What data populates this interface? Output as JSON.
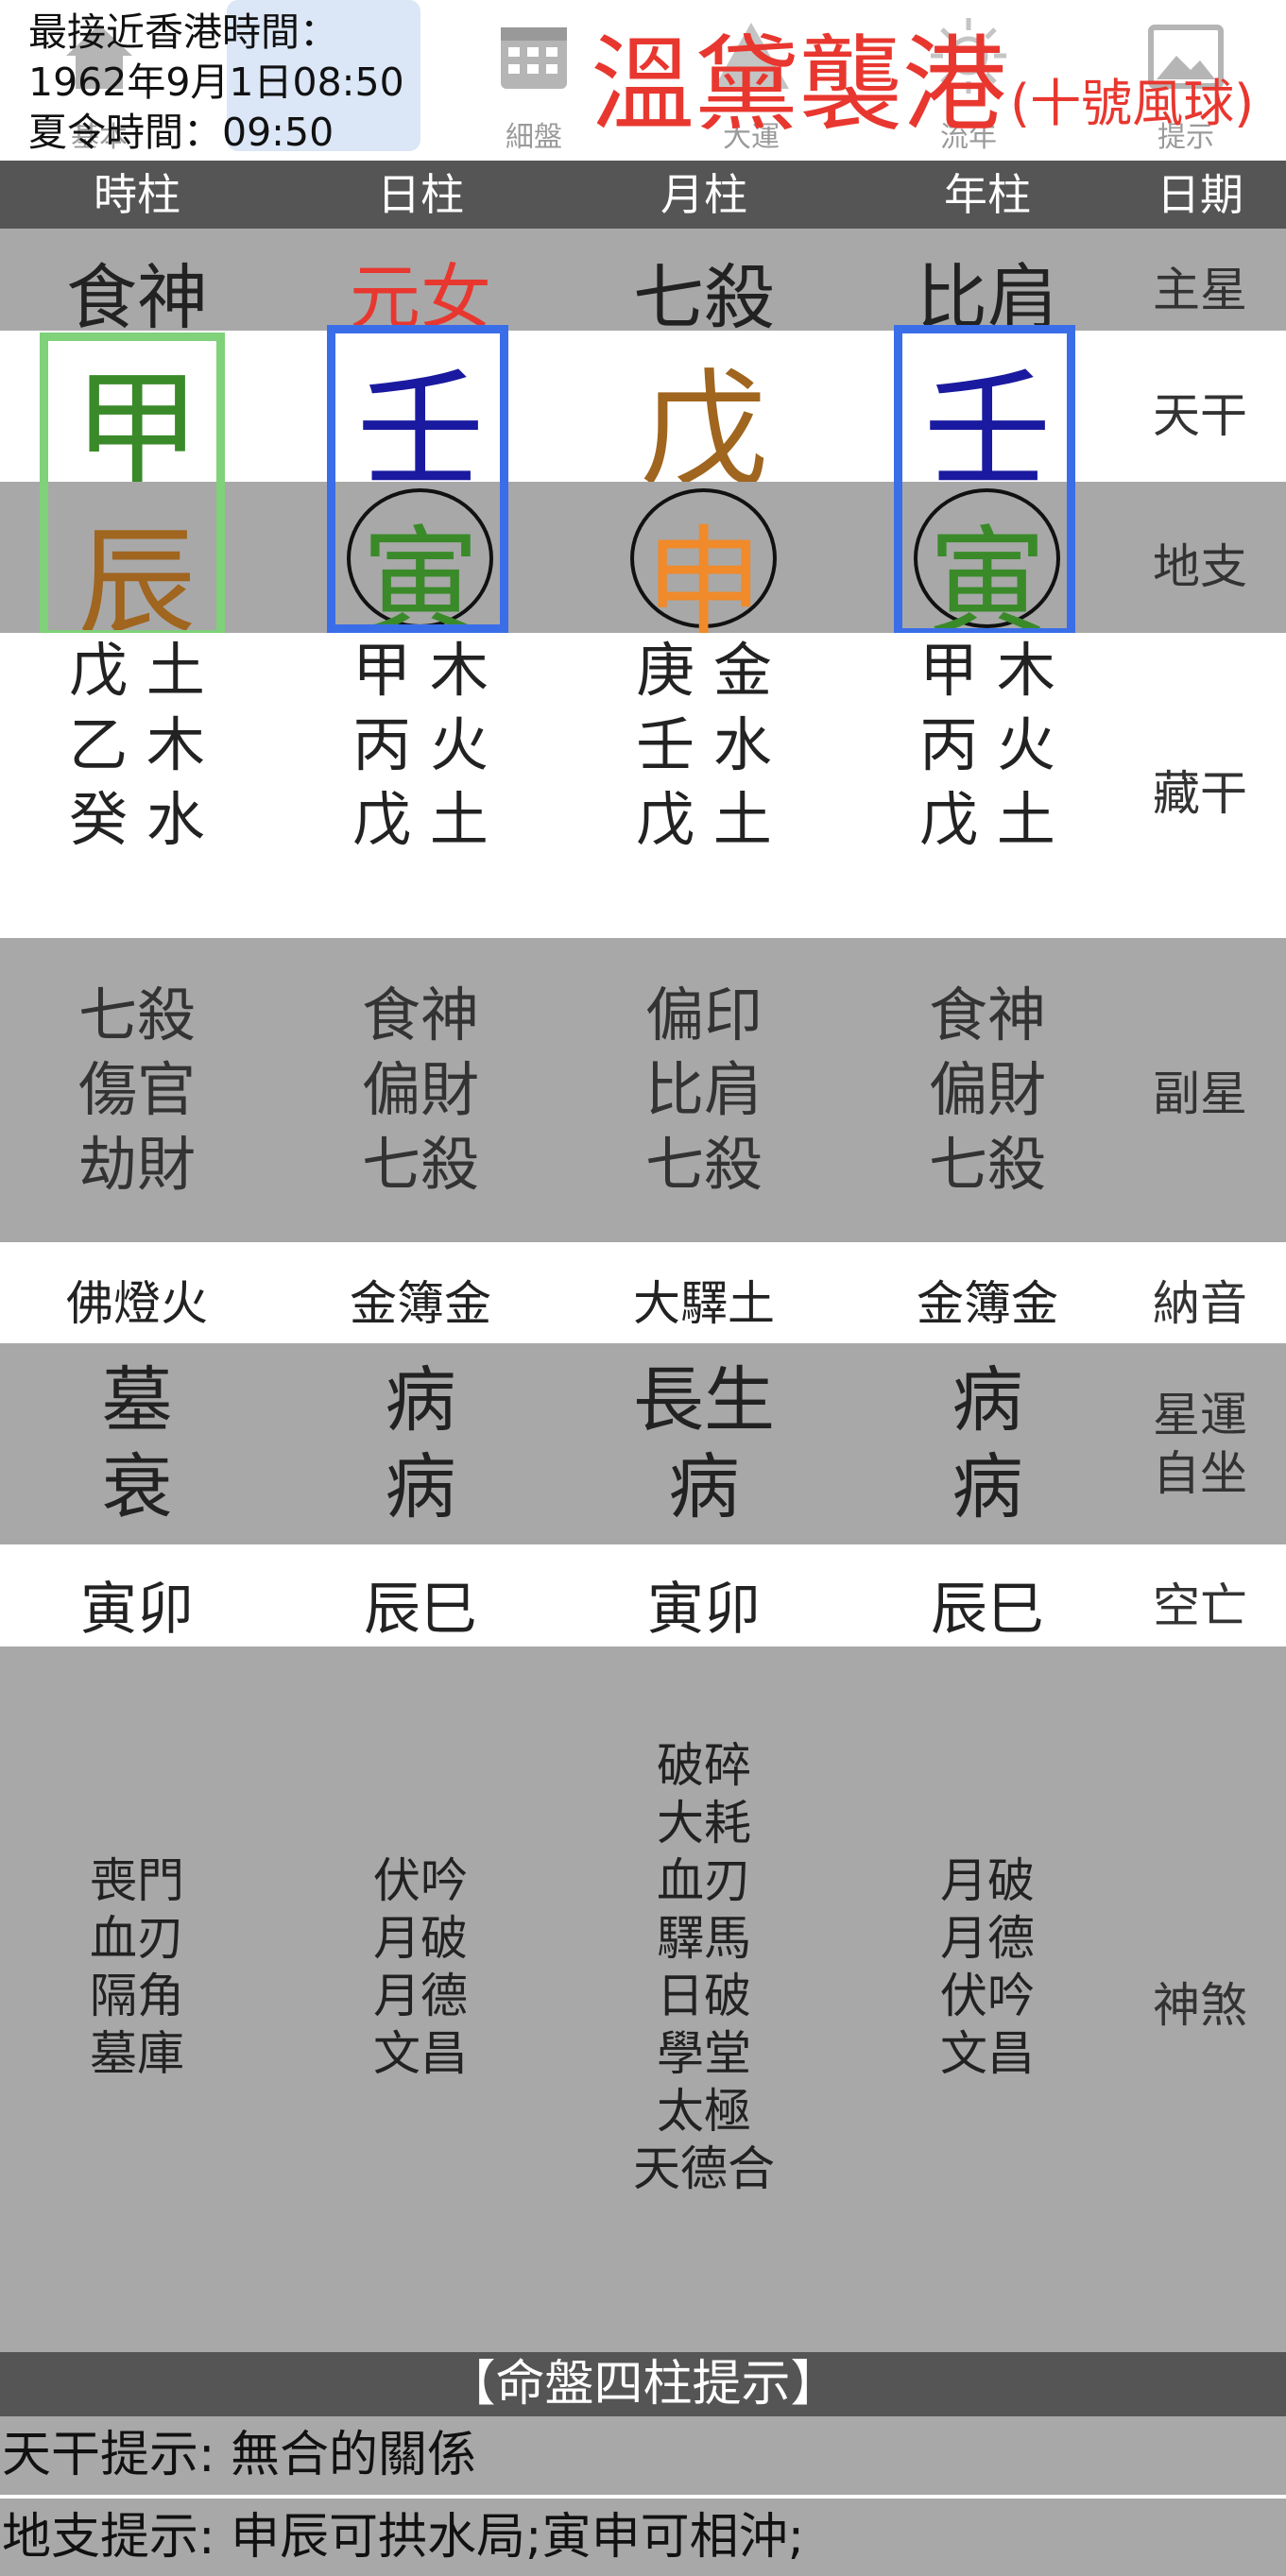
{
  "toolbar": {
    "tabs": [
      {
        "label": "基本"
      },
      {
        "label": "細盤"
      },
      {
        "label": "大運"
      },
      {
        "label": "流年"
      },
      {
        "label": "提示"
      }
    ],
    "time_line1": "最接近香港時間：",
    "time_line2": "1962年9月1日08:50",
    "time_line3": "夏令時間：09:50",
    "storm_name": "溫黛襲港",
    "storm_signal": "(十號風球)"
  },
  "header": {
    "columns": [
      "時柱",
      "日柱",
      "月柱",
      "年柱",
      "日期"
    ]
  },
  "rows": {
    "main_star": {
      "label": "主星",
      "values": [
        "食神",
        "元女",
        "七殺",
        "比肩"
      ]
    },
    "heavenly_stem": {
      "label": "天干",
      "values": [
        "甲",
        "壬",
        "戊",
        "壬"
      ]
    },
    "earthly_branch": {
      "label": "地支",
      "values": [
        "辰",
        "寅",
        "申",
        "寅"
      ]
    },
    "hidden_stems": {
      "label": "藏干",
      "values": [
        [
          "戊 土",
          "乙 木",
          "癸 水"
        ],
        [
          "甲 木",
          "丙 火",
          "戊 土"
        ],
        [
          "庚 金",
          "壬 水",
          "戊 土"
        ],
        [
          "甲 木",
          "丙 火",
          "戊 土"
        ]
      ]
    },
    "sub_star": {
      "label": "副星",
      "values": [
        [
          "七殺",
          "傷官",
          "劫財"
        ],
        [
          "食神",
          "偏財",
          "七殺"
        ],
        [
          "偏印",
          "比肩",
          "七殺"
        ],
        [
          "食神",
          "偏財",
          "七殺"
        ]
      ]
    },
    "nayin": {
      "label": "納音",
      "values": [
        "佛燈火",
        "金簿金",
        "大驛土",
        "金簿金"
      ]
    },
    "star_luck": {
      "label_line1": "星運",
      "label_line2": "自坐",
      "values": [
        [
          "墓",
          "衰"
        ],
        [
          "病",
          "病"
        ],
        [
          "長生",
          "病"
        ],
        [
          "病",
          "病"
        ]
      ]
    },
    "kong_wang": {
      "label": "空亡",
      "values": [
        "寅卯",
        "辰巳",
        "寅卯",
        "辰巳"
      ]
    },
    "shen_sha": {
      "label": "神煞",
      "values": [
        [
          "喪門",
          "血刃",
          "隔角",
          "墓庫"
        ],
        [
          "伏吟",
          "月破",
          "月德",
          "文昌"
        ],
        [
          "破碎",
          "大耗",
          "血刃",
          "驛馬",
          "日破",
          "學堂",
          "太極",
          "天德合"
        ],
        [
          "月破",
          "月德",
          "伏吟",
          "文昌"
        ]
      ]
    }
  },
  "hints": {
    "title": "【命盤四柱提示】",
    "stem_hint": "天干提示: 無合的關係",
    "branch_hint": "地支提示: 申辰可拱水局;寅申可相沖;"
  },
  "colors": {
    "wood": "#3a8a2a",
    "water": "#1a1aa0",
    "earth": "#a0651e",
    "metal": "#f08a2a",
    "accent_red": "#e8372f",
    "green_box": "#7fd17a",
    "blue_box": "#3a6ee8"
  },
  "icons": [
    "home-icon",
    "calendar-icon",
    "mountain-icon",
    "sun-icon",
    "picture-icon"
  ]
}
